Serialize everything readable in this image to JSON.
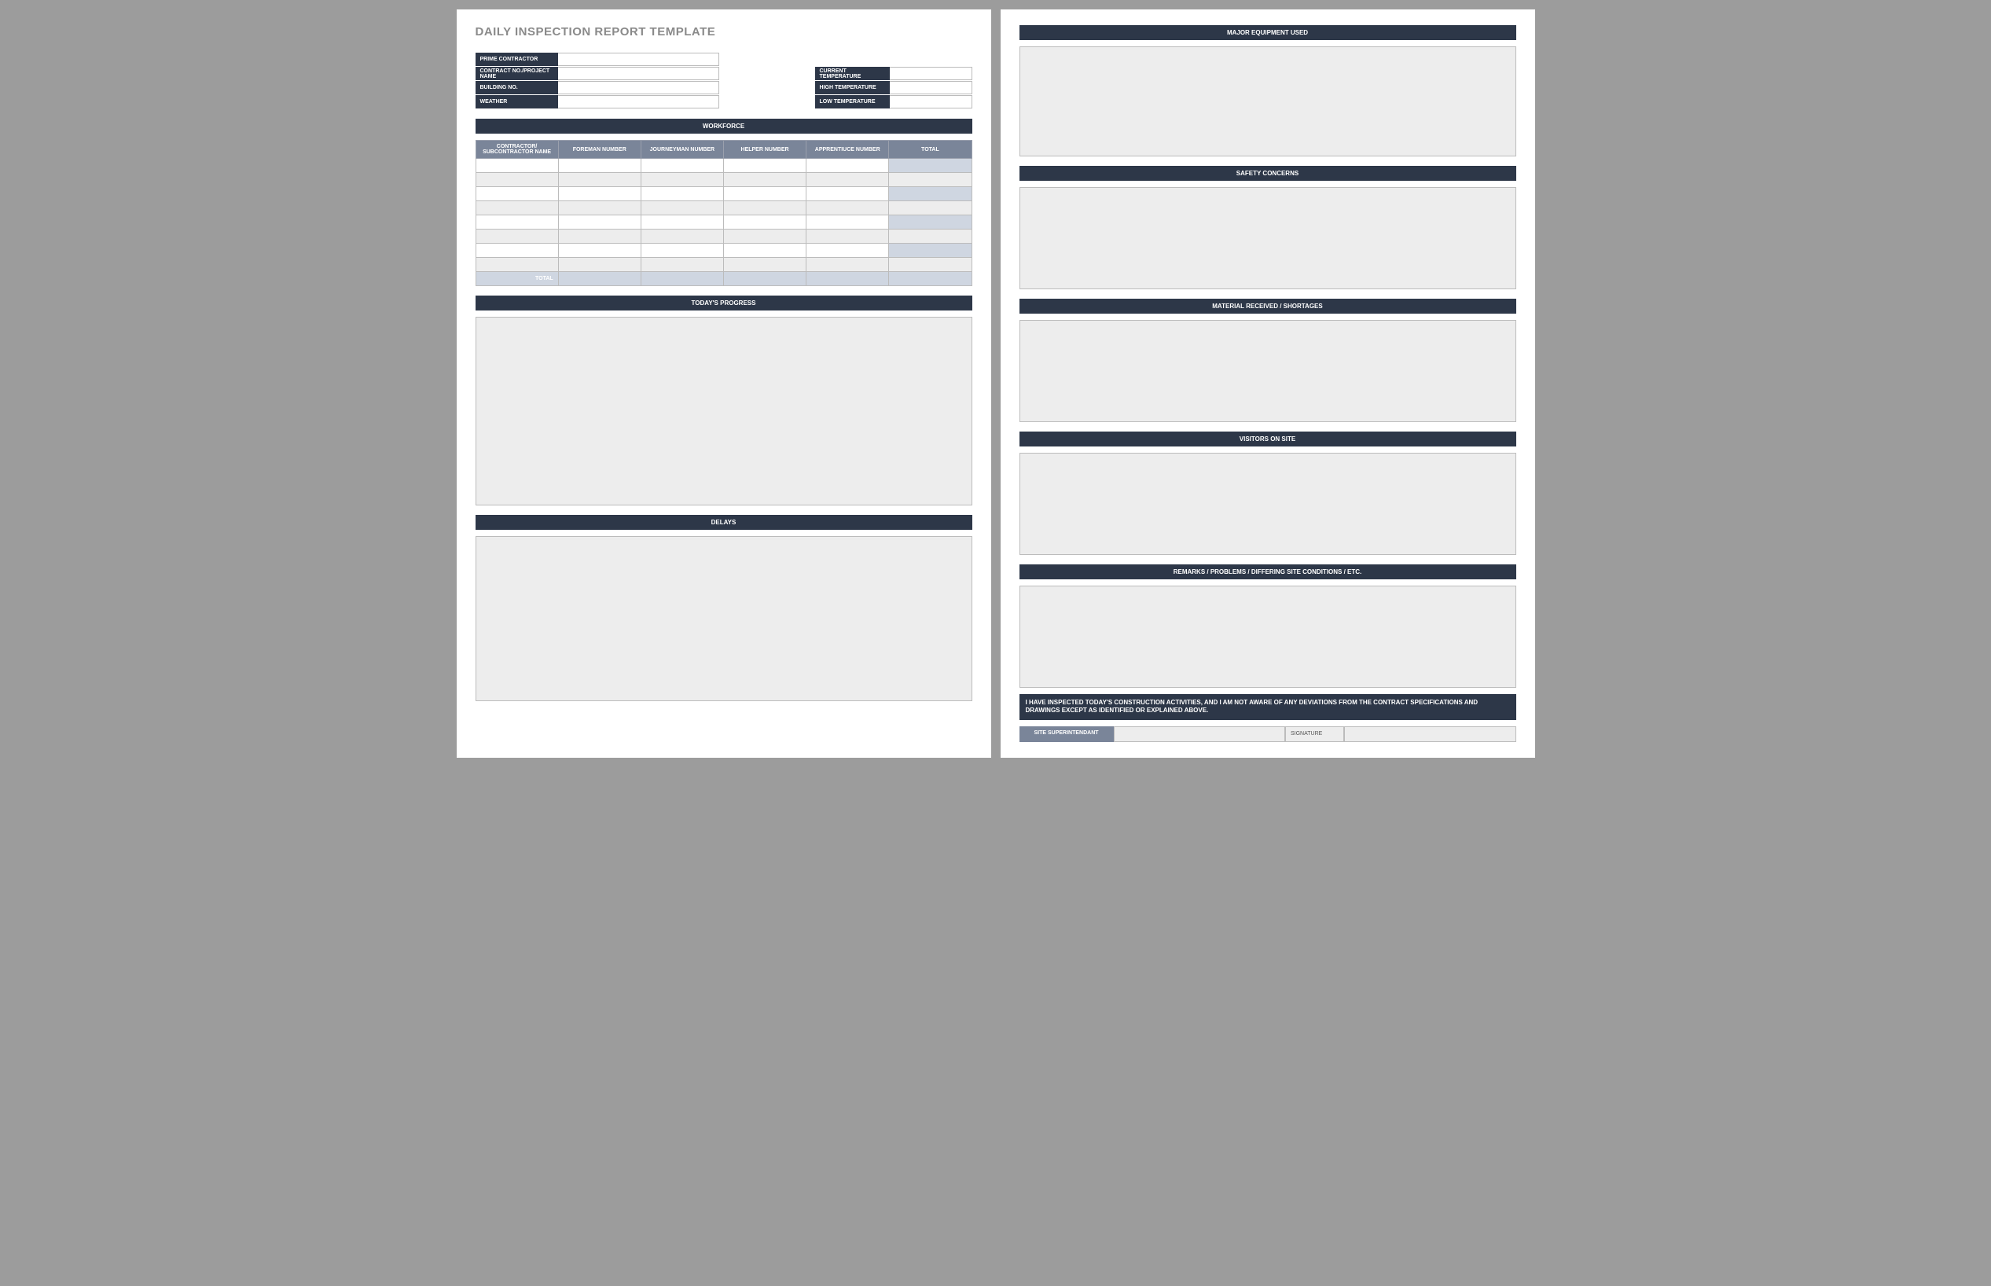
{
  "title": "DAILY INSPECTION REPORT TEMPLATE",
  "info_left": {
    "prime_contractor": {
      "label": "PRIME CONTRACTOR",
      "value": ""
    },
    "contract_no": {
      "label": "CONTRACT NO./PROJECT NAME",
      "value": ""
    },
    "building_no": {
      "label": "BUILDING NO.",
      "value": ""
    },
    "weather": {
      "label": "WEATHER",
      "value": ""
    }
  },
  "info_right": {
    "current_temp": {
      "label": "CURRENT TEMPERATURE",
      "value": ""
    },
    "high_temp": {
      "label": "HIGH TEMPERATURE",
      "value": ""
    },
    "low_temp": {
      "label": "LOW TEMPERATURE",
      "value": ""
    }
  },
  "workforce": {
    "header": "WORKFORCE",
    "columns": [
      "CONTRACTOR/ SUBCONTRACTOR NAME",
      "FOREMAN NUMBER",
      "JOURNEYMAN NUMBER",
      "HELPER NUMBER",
      "APPRENTIUCE NUMBER",
      "TOTAL"
    ],
    "rows": [
      [
        "",
        "",
        "",
        "",
        "",
        ""
      ],
      [
        "",
        "",
        "",
        "",
        "",
        ""
      ],
      [
        "",
        "",
        "",
        "",
        "",
        ""
      ],
      [
        "",
        "",
        "",
        "",
        "",
        ""
      ],
      [
        "",
        "",
        "",
        "",
        "",
        ""
      ],
      [
        "",
        "",
        "",
        "",
        "",
        ""
      ],
      [
        "",
        "",
        "",
        "",
        "",
        ""
      ],
      [
        "",
        "",
        "",
        "",
        "",
        ""
      ]
    ],
    "total_label": "TOTAL",
    "totals": [
      "",
      "",
      "",
      "",
      ""
    ]
  },
  "sections": {
    "progress": "TODAY'S PROGRESS",
    "delays": "DELAYS",
    "equipment": "MAJOR EQUIPMENT USED",
    "safety": "SAFETY CONCERNS",
    "materials": "MATERIAL RECEIVED / SHORTAGES",
    "visitors": "VISITORS ON SITE",
    "remarks": "REMARKS / PROBLEMS / DIFFERING SITE CONDITIONS / ETC."
  },
  "certification": "I HAVE INSPECTED TODAY'S CONSTRUCTION ACTIVITIES, AND I AM NOT AWARE OF ANY DEVIATIONS FROM THE CONTRACT SPECIFICATIONS AND DRAWINGS EXCEPT AS IDENTIFIED OR EXPLAINED ABOVE.",
  "signature": {
    "role": "SITE SUPERINTENDANT",
    "sig_label": "SIGNATURE"
  }
}
